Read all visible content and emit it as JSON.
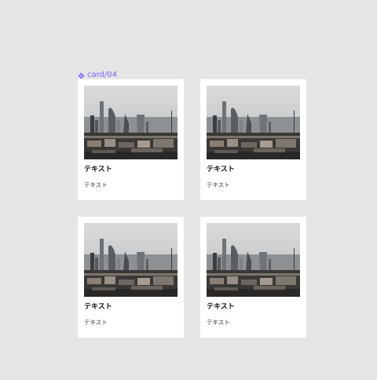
{
  "frame": {
    "name": "card/04",
    "icon": "component-icon",
    "accent_color": "#7b61ff"
  },
  "canvas_background": "#e5e5e5",
  "cards": [
    {
      "image": "london-skyline-photo",
      "title": "テキスト",
      "body": "テキスト"
    },
    {
      "image": "london-skyline-photo",
      "title": "テキスト",
      "body": "テキスト"
    },
    {
      "image": "london-skyline-photo",
      "title": "テキスト",
      "body": "テキスト"
    },
    {
      "image": "london-skyline-photo",
      "title": "テキスト",
      "body": "テキスト"
    }
  ]
}
